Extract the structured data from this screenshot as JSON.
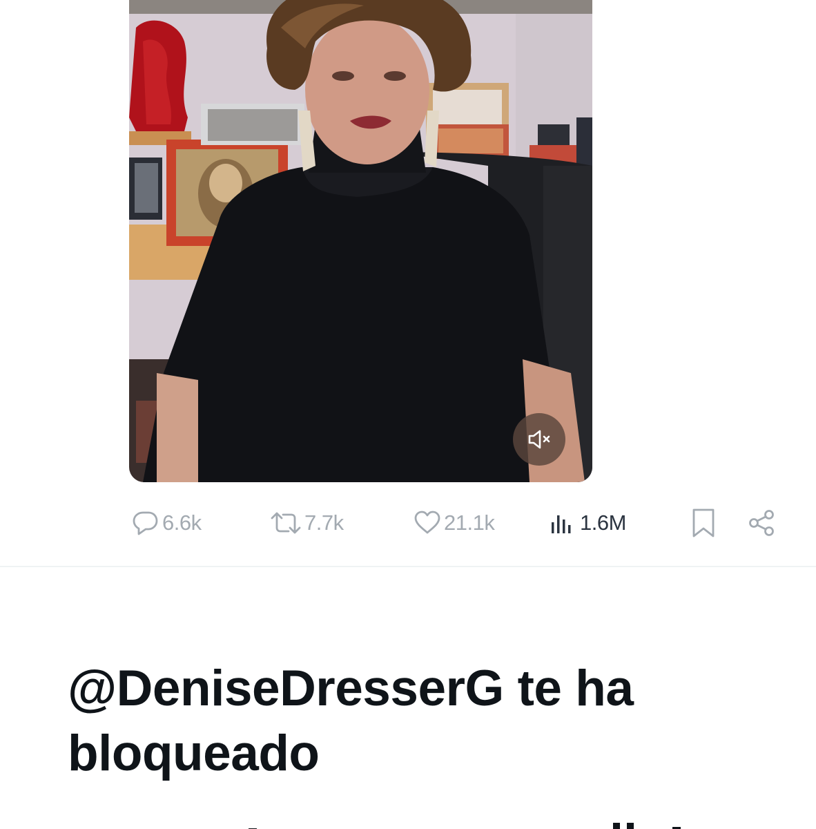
{
  "media": {
    "mute_label": "Mute"
  },
  "actions": {
    "replies": "6.6k",
    "reposts": "7.7k",
    "likes": "21.1k",
    "views": "1.6M"
  },
  "blocked": {
    "title": "@DeniseDresserG te ha bloqueado"
  },
  "colors": {
    "muted_icon": "#a3aab1",
    "views_icon": "#2b3440",
    "title_text": "#0f1419",
    "divider": "#eff3f4"
  }
}
